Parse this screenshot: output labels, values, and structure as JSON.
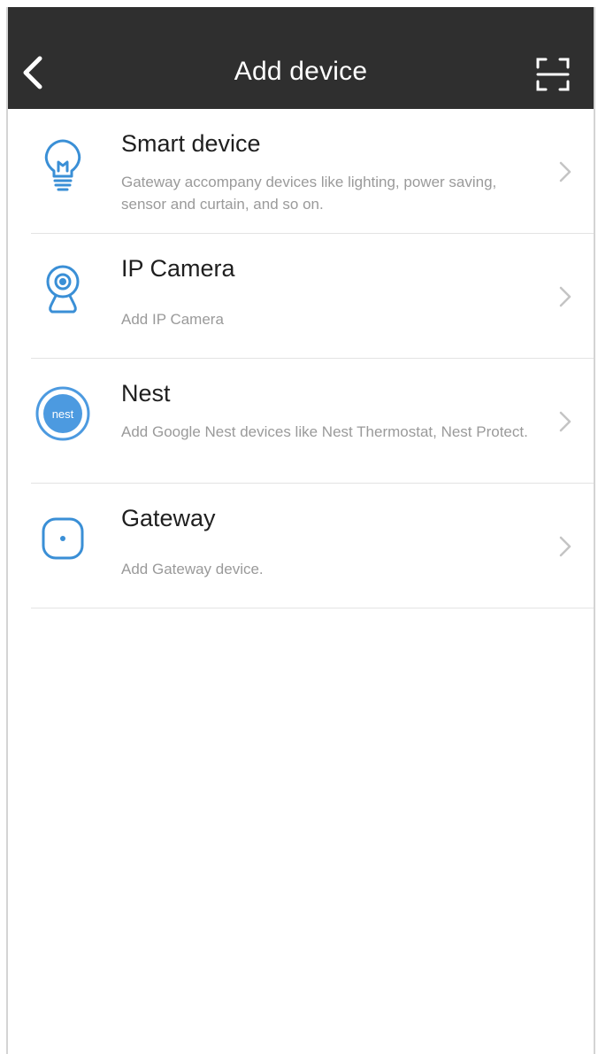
{
  "header": {
    "title": "Add device"
  },
  "colors": {
    "header_bg": "#2f2f2f",
    "icon_blue": "#3a8fd6",
    "nest_blue": "#4c9ae0",
    "label": "#1f1f1f",
    "desc": "#9a9a9a"
  },
  "items": [
    {
      "label": "Smart device",
      "description": "Gateway accompany devices like lighting, power saving, sensor and curtain, and so on.",
      "icon": "lightbulb-icon"
    },
    {
      "label": "IP Camera",
      "description": "Add IP Camera",
      "icon": "camera-icon"
    },
    {
      "label": "Nest",
      "description": "Add Google Nest devices like Nest Thermostat, Nest Protect.",
      "icon": "nest-icon",
      "icon_text": "nest"
    },
    {
      "label": "Gateway",
      "description": "Add Gateway device.",
      "icon": "gateway-icon"
    }
  ]
}
